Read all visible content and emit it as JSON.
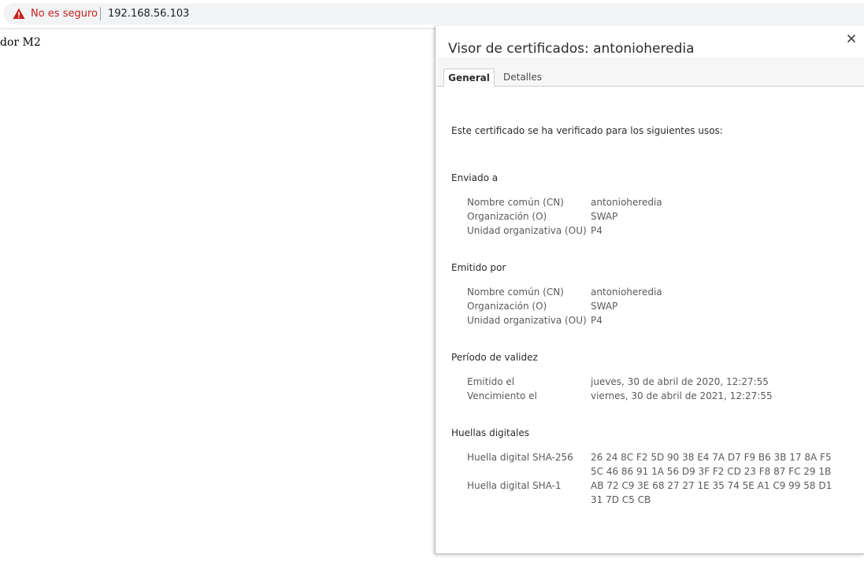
{
  "browser": {
    "security_label": "No es seguro",
    "url": "192.168.56.103",
    "warning_color": "#c5221f"
  },
  "page": {
    "text": "dor M2"
  },
  "dialog": {
    "title": "Visor de certificados: antonioheredia",
    "close_icon": "close-icon",
    "tabs": [
      {
        "label": "General",
        "active": true
      },
      {
        "label": "Detalles",
        "active": false
      }
    ],
    "intro": "Este certificado se ha verificado para los siguientes usos:",
    "issued_to": {
      "heading": "Enviado a",
      "rows": [
        {
          "key": "Nombre común (CN)",
          "value": "antonioheredia"
        },
        {
          "key": "Organización (O)",
          "value": "SWAP"
        },
        {
          "key": "Unidad organizativa (OU)",
          "value": "P4"
        }
      ]
    },
    "issued_by": {
      "heading": "Emitido por",
      "rows": [
        {
          "key": "Nombre común (CN)",
          "value": "antonioheredia"
        },
        {
          "key": "Organización (O)",
          "value": "SWAP"
        },
        {
          "key": "Unidad organizativa (OU)",
          "value": "P4"
        }
      ]
    },
    "validity": {
      "heading": "Período de validez",
      "rows": [
        {
          "key": "Emitido el",
          "value": "jueves, 30 de abril de 2020, 12:27:55"
        },
        {
          "key": "Vencimiento el",
          "value": "viernes, 30 de abril de 2021, 12:27:55"
        }
      ]
    },
    "fingerprints": {
      "heading": "Huellas digitales",
      "sha256": {
        "key": "Huella digital SHA-256",
        "line1": "26 24 8C F2 5D 90 38 E4 7A D7 F9 B6 3B 17 8A F5",
        "line2": "5C 46 86 91 1A 56 D9 3F F2 CD 23 F8 87 FC 29 1B"
      },
      "sha1": {
        "key": "Huella digital SHA-1",
        "line1": "AB 72 C9 3E 68 27 27 1E 35 74 5E A1 C9 99 58 D1",
        "line2": "31 7D C5 CB"
      }
    }
  }
}
